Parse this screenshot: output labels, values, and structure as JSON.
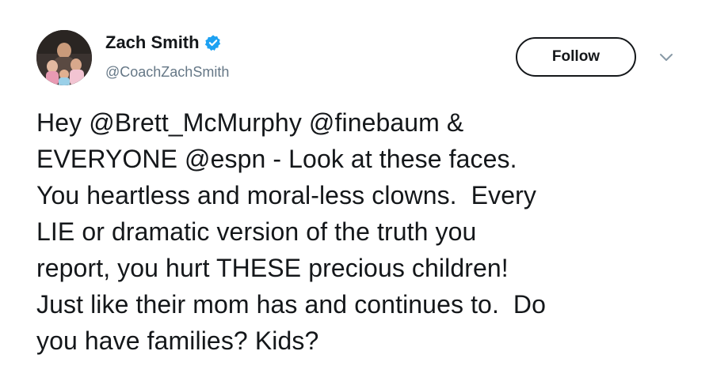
{
  "user": {
    "display_name": "Zach Smith",
    "handle": "@CoachZachSmith",
    "verified": true
  },
  "actions": {
    "follow_label": "Follow"
  },
  "icons": {
    "verified": "verified-badge-icon",
    "more": "chevron-down-icon"
  },
  "tweet": {
    "lines": [
      "Hey @Brett_McMurphy @finebaum &",
      "EVERYONE @espn - Look at these faces.",
      "You heartless and moral-less clowns.  Every",
      "LIE or dramatic version of the truth you",
      "report, you hurt THESE precious children!",
      "Just like their mom has and continues to.  Do",
      "you have families? Kids?"
    ]
  },
  "colors": {
    "text": "#14171a",
    "secondary": "#657786",
    "verified_blue": "#1da1f2"
  }
}
